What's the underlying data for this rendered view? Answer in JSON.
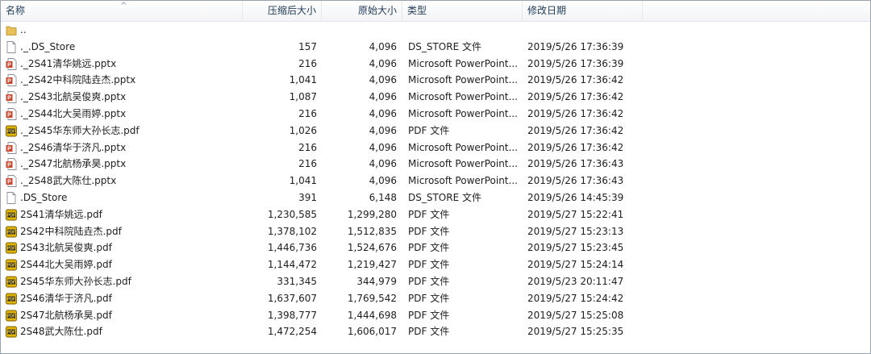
{
  "columns": {
    "name": "名称",
    "compressed_size": "压缩后大小",
    "original_size": "原始大小",
    "type": "类型",
    "modified": "修改日期"
  },
  "files": [
    {
      "icon": "folder-icon",
      "name": "..",
      "compressed": "",
      "original": "",
      "type": "",
      "date": ""
    },
    {
      "icon": "file-icon",
      "name": "._.DS_Store",
      "compressed": "157",
      "original": "4,096",
      "type": "DS_STORE 文件",
      "date": "2019/5/26 17:36:39"
    },
    {
      "icon": "pptx-icon",
      "name": "._2S41清华姚远.pptx",
      "compressed": "216",
      "original": "4,096",
      "type": "Microsoft PowerPoint...",
      "date": "2019/5/26 17:36:39"
    },
    {
      "icon": "pptx-icon",
      "name": "._2S42中科院陆垚杰.pptx",
      "compressed": "1,041",
      "original": "4,096",
      "type": "Microsoft PowerPoint...",
      "date": "2019/5/26 17:36:42"
    },
    {
      "icon": "pptx-icon",
      "name": "._2S43北航吴俊爽.pptx",
      "compressed": "1,087",
      "original": "4,096",
      "type": "Microsoft PowerPoint...",
      "date": "2019/5/26 17:36:42"
    },
    {
      "icon": "pptx-icon",
      "name": "._2S44北大吴雨婷.pptx",
      "compressed": "216",
      "original": "4,096",
      "type": "Microsoft PowerPoint...",
      "date": "2019/5/26 17:36:42"
    },
    {
      "icon": "pdf-icon",
      "name": "._2S45华东师大孙长志.pdf",
      "compressed": "1,026",
      "original": "4,096",
      "type": "PDF 文件",
      "date": "2019/5/26 17:36:42"
    },
    {
      "icon": "pptx-icon",
      "name": "._2S46清华于济凡.pptx",
      "compressed": "216",
      "original": "4,096",
      "type": "Microsoft PowerPoint...",
      "date": "2019/5/26 17:36:42"
    },
    {
      "icon": "pptx-icon",
      "name": "._2S47北航杨承昊.pptx",
      "compressed": "216",
      "original": "4,096",
      "type": "Microsoft PowerPoint...",
      "date": "2019/5/26 17:36:43"
    },
    {
      "icon": "pptx-icon",
      "name": "._2S48武大陈仕.pptx",
      "compressed": "1,041",
      "original": "4,096",
      "type": "Microsoft PowerPoint...",
      "date": "2019/5/26 17:36:43"
    },
    {
      "icon": "file-icon",
      "name": ".DS_Store",
      "compressed": "391",
      "original": "6,148",
      "type": "DS_STORE 文件",
      "date": "2019/5/26 14:45:39"
    },
    {
      "icon": "pdf-icon",
      "name": "2S41清华姚远.pdf",
      "compressed": "1,230,585",
      "original": "1,299,280",
      "type": "PDF 文件",
      "date": "2019/5/27 15:22:41"
    },
    {
      "icon": "pdf-icon",
      "name": "2S42中科院陆垚杰.pdf",
      "compressed": "1,378,102",
      "original": "1,512,835",
      "type": "PDF 文件",
      "date": "2019/5/27 15:23:13"
    },
    {
      "icon": "pdf-icon",
      "name": "2S43北航吴俊爽.pdf",
      "compressed": "1,446,736",
      "original": "1,524,676",
      "type": "PDF 文件",
      "date": "2019/5/27 15:23:45"
    },
    {
      "icon": "pdf-icon",
      "name": "2S44北大吴雨婷.pdf",
      "compressed": "1,144,472",
      "original": "1,219,427",
      "type": "PDF 文件",
      "date": "2019/5/27 15:24:14"
    },
    {
      "icon": "pdf-icon",
      "name": "2S45华东师大孙长志.pdf",
      "compressed": "331,345",
      "original": "344,979",
      "type": "PDF 文件",
      "date": "2019/5/23 20:11:47"
    },
    {
      "icon": "pdf-icon",
      "name": "2S46清华于济凡.pdf",
      "compressed": "1,637,607",
      "original": "1,769,542",
      "type": "PDF 文件",
      "date": "2019/5/27 15:24:42"
    },
    {
      "icon": "pdf-icon",
      "name": "2S47北航杨承昊.pdf",
      "compressed": "1,398,777",
      "original": "1,444,698",
      "type": "PDF 文件",
      "date": "2019/5/27 15:25:08"
    },
    {
      "icon": "pdf-icon",
      "name": "2S48武大陈仕.pdf",
      "compressed": "1,472,254",
      "original": "1,606,017",
      "type": "PDF 文件",
      "date": "2019/5/27 15:25:35"
    }
  ],
  "colors": {
    "pptx_icon": "#c8472f",
    "pdf_icon": "#e0b400",
    "folder_icon": "#e8c15a"
  }
}
